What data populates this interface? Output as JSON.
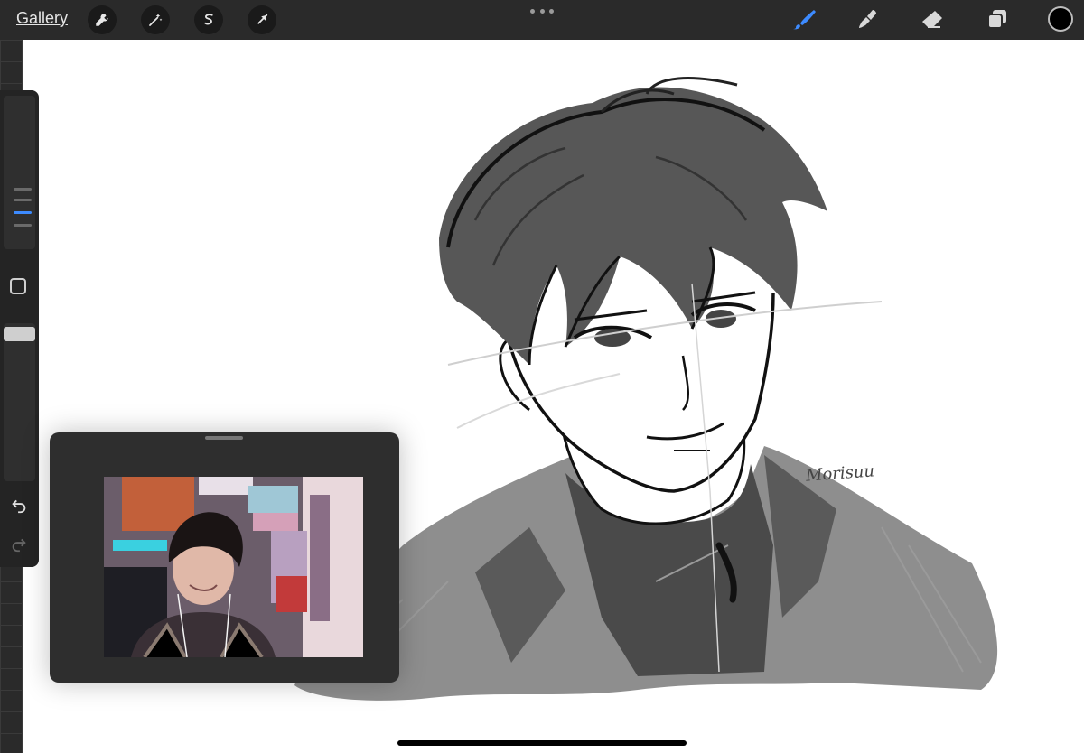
{
  "toolbar": {
    "gallery_label": "Gallery",
    "left_tools": [
      {
        "name": "wrench-icon"
      },
      {
        "name": "magic-wand-icon"
      },
      {
        "name": "selection-icon"
      },
      {
        "name": "transform-arrow-icon"
      }
    ],
    "right_tools": [
      {
        "name": "brush-icon",
        "active_color": "#3d8bff"
      },
      {
        "name": "smudge-icon"
      },
      {
        "name": "eraser-icon"
      },
      {
        "name": "layers-icon"
      }
    ],
    "current_color": "#000000"
  },
  "sidebar": {
    "brush_size_icon": "brush-size-slider",
    "modify_button": "square-modify-icon",
    "opacity_icon": "opacity-slider",
    "undo": "undo-icon",
    "redo": "redo-icon"
  },
  "canvas": {
    "signature_text": "Morisuu"
  },
  "colors": {
    "accent": "#3d8bff",
    "toolbar_bg": "#2a2a2a"
  }
}
